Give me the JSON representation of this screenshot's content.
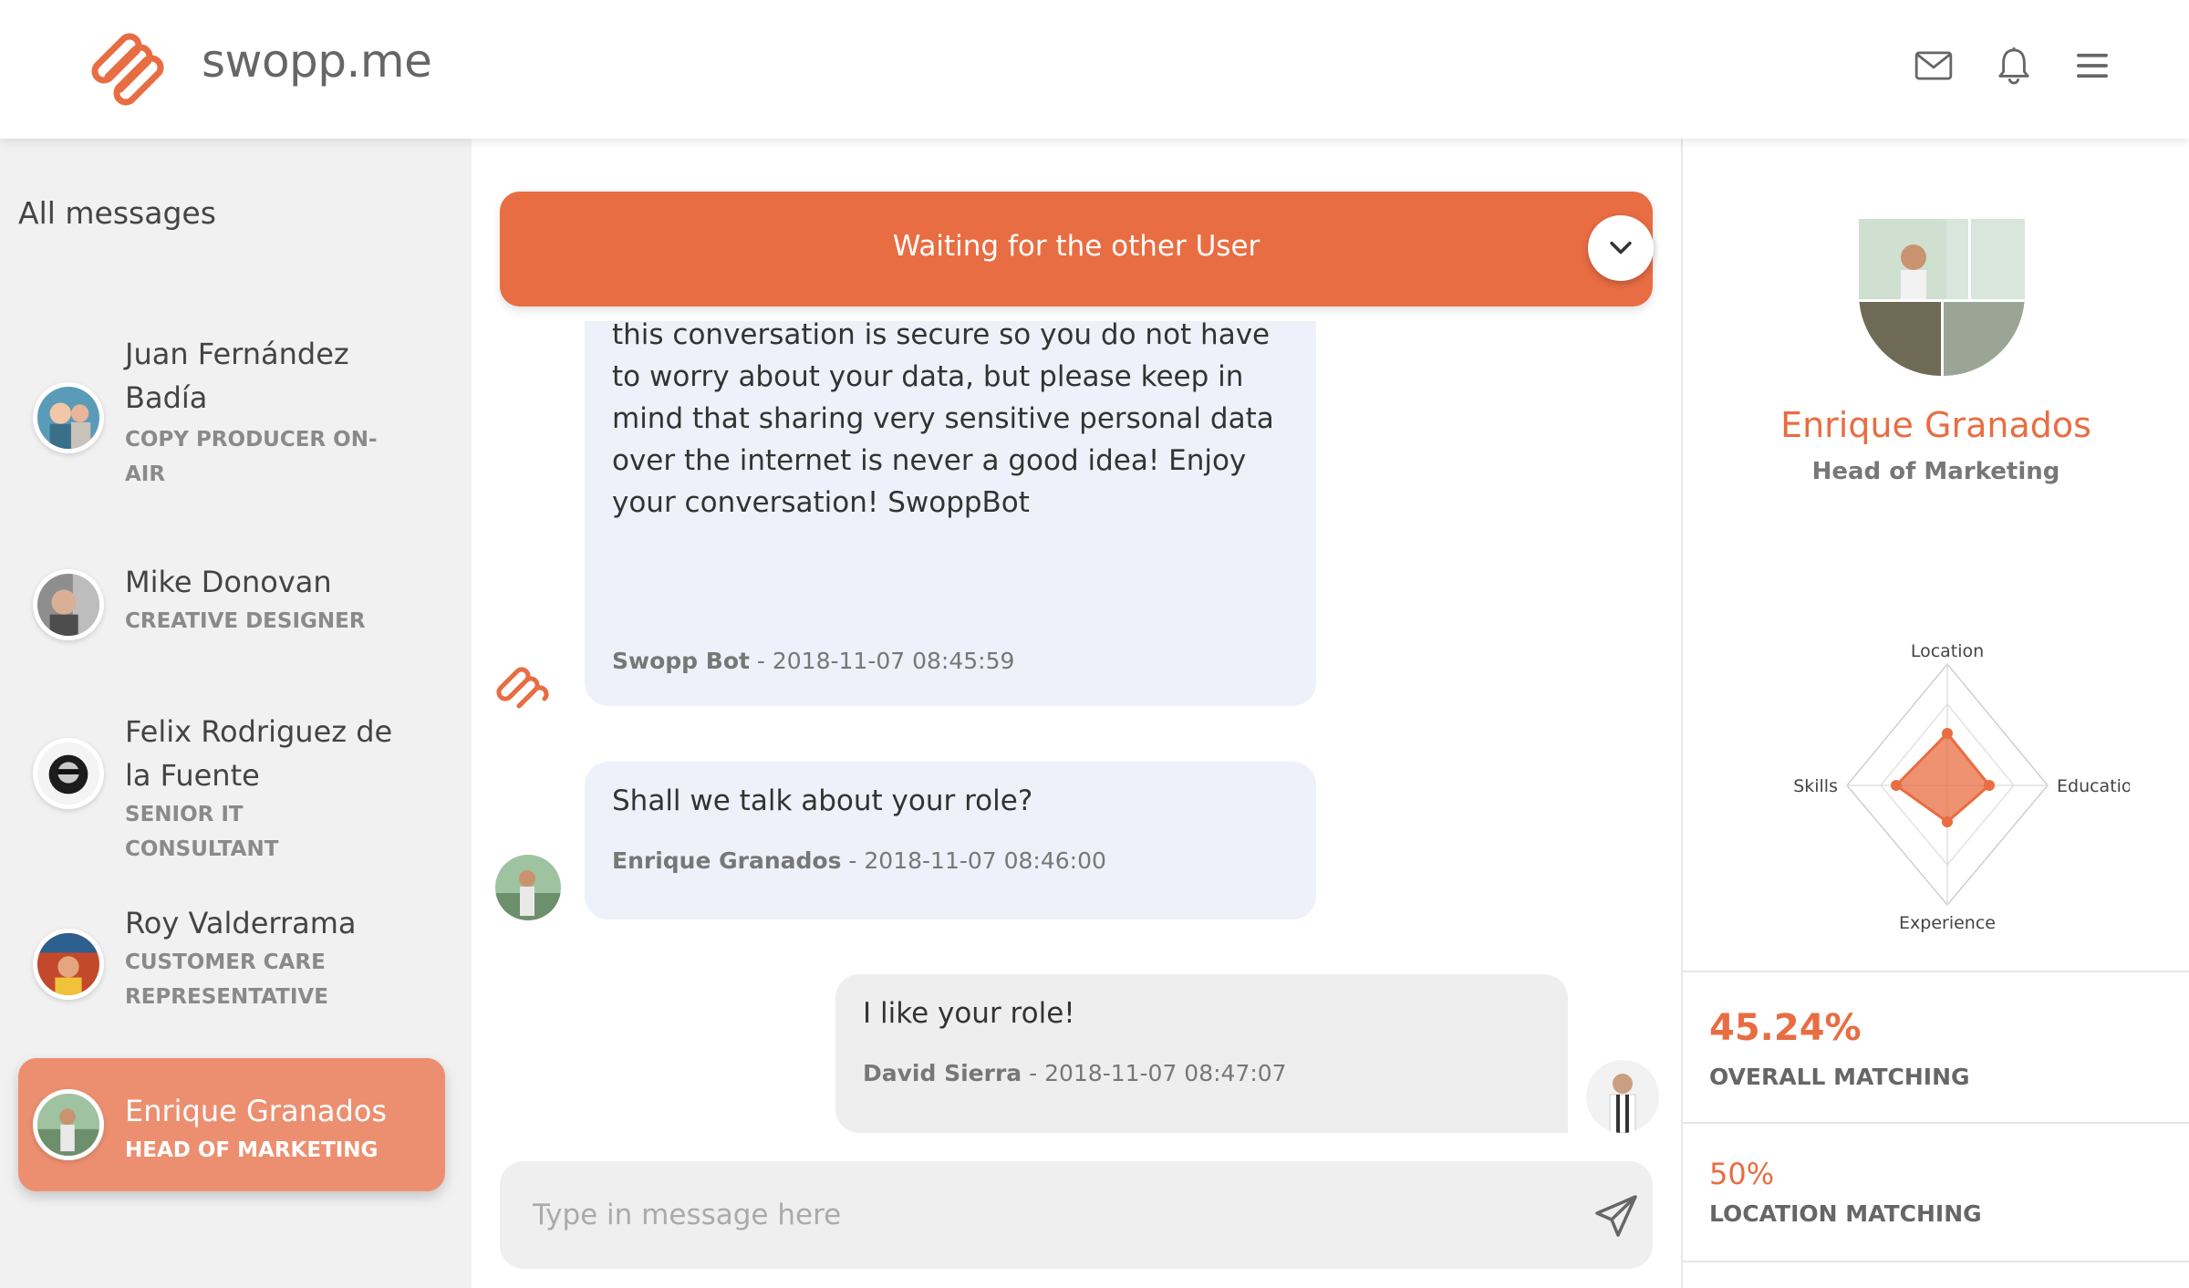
{
  "app": {
    "brand": "swopp.me",
    "accent_color": "#e86d42",
    "icons": [
      "mail-icon",
      "bell-icon",
      "menu-icon"
    ]
  },
  "sidebar": {
    "title": "All messages",
    "contacts": [
      {
        "name": "Juan Fernández Badía",
        "role": "COPY PRODUCER ON-AIR",
        "active": false
      },
      {
        "name": "Mike Donovan",
        "role": "CREATIVE DESIGNER",
        "active": false
      },
      {
        "name": "Felix Rodriguez de la Fuente",
        "role": "SENIOR IT CONSULTANT",
        "active": false
      },
      {
        "name": "Roy Valderrama",
        "role": "CUSTOMER CARE REPRESENTATIVE",
        "active": false
      },
      {
        "name": "Enrique Granados",
        "role": "HEAD OF MARKETING",
        "active": true
      }
    ]
  },
  "chat": {
    "banner": "Waiting for the other User",
    "messages": [
      {
        "text": "about more details. Please, do not be shy! One more thing you probably need to know is that this conversation is secure so you do not have to worry about your data, but please keep in mind that sharing very sensitive personal data over the internet is never a good idea! Enjoy your conversation! SwoppBot",
        "author": "Swopp Bot",
        "time": "- 2018-11-07 08:45:59",
        "direction": "in"
      },
      {
        "text": "Shall we talk about your role?",
        "author": "Enrique Granados",
        "time": "- 2018-11-07 08:46:00",
        "direction": "in"
      },
      {
        "text": "I like your role!",
        "author": "David Sierra",
        "time": "- 2018-11-07 08:47:07",
        "direction": "out"
      }
    ],
    "input_placeholder": "Type in message here",
    "input_value": ""
  },
  "profile": {
    "name": "Enrique Granados",
    "role": "Head of Marketing",
    "radar": {
      "labels": {
        "top": "Location",
        "right": "Education",
        "bottom": "Experience",
        "left": "Skills"
      }
    },
    "stats": [
      {
        "value": "45.24%",
        "label": "OVERALL MATCHING"
      },
      {
        "value": "50%",
        "label": "LOCATION MATCHING"
      }
    ]
  }
}
